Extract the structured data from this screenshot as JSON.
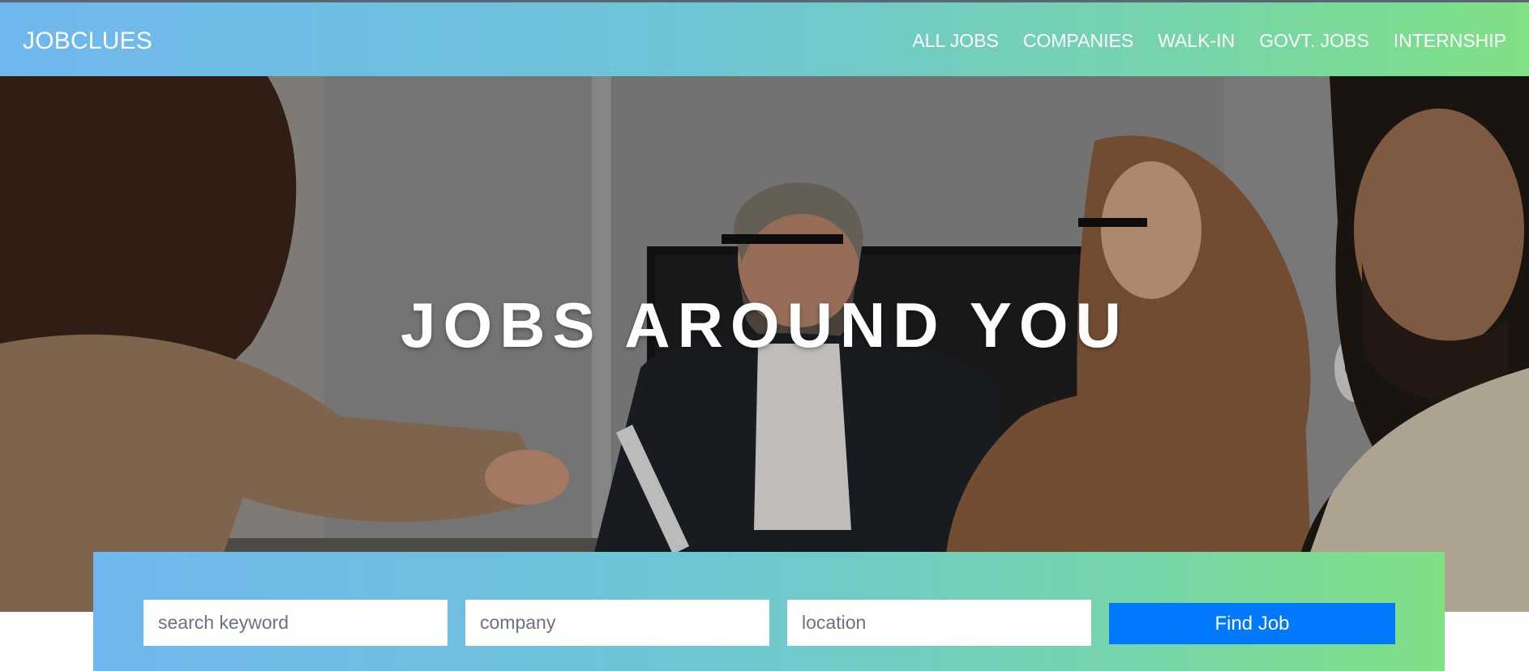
{
  "header": {
    "brand": "JOBCLUES",
    "nav": [
      {
        "label": "ALL JOBS"
      },
      {
        "label": "COMPANIES"
      },
      {
        "label": "WALK-IN"
      },
      {
        "label": "GOVT. JOBS"
      },
      {
        "label": "INTERNSHIP"
      }
    ]
  },
  "hero": {
    "title": "JOBS AROUND YOU",
    "image": "business-meeting-handshake-photo"
  },
  "search": {
    "keyword_placeholder": "search keyword",
    "company_placeholder": "company",
    "location_placeholder": "location",
    "button_label": "Find Job"
  },
  "colors": {
    "gradient_start": "#6fb7ef",
    "gradient_end": "#7fe084",
    "button": "#0078ff"
  }
}
